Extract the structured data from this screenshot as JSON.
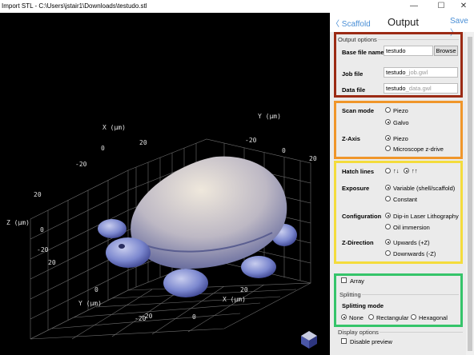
{
  "window": {
    "title": "Import STL - C:\\Users\\jstair1\\Downloads\\testudo.stl",
    "minimize": "—",
    "maximize": "☐",
    "close": "✕"
  },
  "header": {
    "back_label": "〈 Scaffold",
    "title": "Output",
    "save_label": "Save 〉"
  },
  "output_options": {
    "group_label": "Output options",
    "base_file_name_label": "Base file name",
    "base_file_name_value": "testudo",
    "browse_label": "Browse",
    "job_file_label": "Job file",
    "job_file_value": "testudo",
    "job_file_suffix": "_job.gwl",
    "data_file_label": "Data file",
    "data_file_value": "testudo",
    "data_file_suffix": "_data.gwl"
  },
  "scan": {
    "scan_mode_label": "Scan mode",
    "scan_options": [
      "Piezo",
      "Galvo"
    ],
    "scan_selected": "Galvo",
    "zaxis_label": "Z-Axis",
    "zaxis_options": [
      "Piezo",
      "Microscope z-drive"
    ],
    "zaxis_selected": "Piezo"
  },
  "hatch": {
    "hatch_label": "Hatch lines",
    "hatch_options": [
      "↑↓",
      "↑↑"
    ],
    "hatch_selected": "↑↑",
    "exposure_label": "Exposure",
    "exposure_options": [
      "Variable (shell/scaffold)",
      "Constant"
    ],
    "exposure_selected": "Variable (shell/scaffold)",
    "configuration_label": "Configuration",
    "configuration_options": [
      "Dip-in Laser Lithography",
      "Oil immersion"
    ],
    "configuration_selected": "Dip-in Laser Lithography",
    "zdirection_label": "Z-Direction",
    "zdirection_options": [
      "Upwards (+Z)",
      "Downwards (-Z)"
    ],
    "zdirection_selected": "Upwards (+Z)"
  },
  "splitting": {
    "array_label": "Array",
    "array_checked": false,
    "group_label": "Splitting",
    "mode_label": "Splitting mode",
    "options": [
      "None",
      "Rectangular",
      "Hexagonal"
    ],
    "selected": "None"
  },
  "display": {
    "group_label": "Display options",
    "disable_preview_label": "Disable preview",
    "disable_preview_checked": false
  },
  "viewport": {
    "axis_x_label_top": "X (μm)",
    "axis_y_label_top": "Y (μm)",
    "axis_z_label": "Z (μm)",
    "axis_y_label_bottom": "Y (μm)",
    "axis_x_label_bottom": "X (μm)",
    "ticks": [
      "0",
      "-20",
      "20",
      "-20",
      "0",
      "20",
      "20",
      "0",
      "-20",
      "20",
      "0",
      "-20",
      "0",
      "20",
      "-20"
    ]
  },
  "colors": {
    "highlight_red": "#9b2a14",
    "highlight_orange": "#f0962a",
    "highlight_yellow": "#f4dc3c",
    "highlight_green": "#35c46a",
    "link_blue": "#4a8fd6",
    "model": "#a8acc8"
  }
}
